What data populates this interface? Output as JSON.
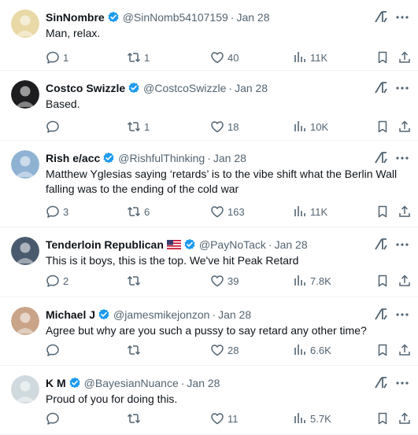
{
  "tweets": [
    {
      "name": "SinNombre",
      "handle": "@SinNomb54107159",
      "date": "Jan 28",
      "text": "Man, relax.",
      "replies": "1",
      "reposts": "1",
      "likes": "40",
      "views": "11K",
      "avatar_color": "#e9d9a6",
      "flag": false
    },
    {
      "name": "Costco Swizzle",
      "handle": "@CostcoSwizzle",
      "date": "Jan 28",
      "text": "Based.",
      "replies": "",
      "reposts": "1",
      "likes": "18",
      "views": "10K",
      "avatar_color": "#1d1d1f",
      "flag": false
    },
    {
      "name": "Rish e/acc",
      "handle": "@RishfulThinking",
      "date": "Jan 28",
      "text": "Matthew Yglesias saying ‘retards’ is to the vibe shift what the Berlin Wall falling was to the ending of the cold war",
      "replies": "3",
      "reposts": "6",
      "likes": "163",
      "views": "11K",
      "avatar_color": "#8fb2d3",
      "flag": false
    },
    {
      "name": "Tenderloin Republican",
      "handle": "@PayNoTack",
      "date": "Jan 28",
      "text": "This is it boys, this is the top. We've hit Peak Retard",
      "replies": "2",
      "reposts": "",
      "likes": "39",
      "views": "7.8K",
      "avatar_color": "#4a5a6e",
      "flag": true
    },
    {
      "name": "Michael J",
      "handle": "@jamesmikejonzon",
      "date": "Jan 28",
      "text": "Agree but why are you such a pussy to say retard any other time?",
      "replies": "",
      "reposts": "",
      "likes": "28",
      "views": "6.6K",
      "avatar_color": "#c9a489",
      "flag": false
    },
    {
      "name": "K M",
      "handle": "@BayesianNuance",
      "date": "Jan 28",
      "text": "Proud of you for doing this.",
      "replies": "",
      "reposts": "",
      "likes": "11",
      "views": "5.7K",
      "avatar_color": "#cfd9de",
      "flag": false
    }
  ],
  "colors": {
    "verified": "#1d9bf0",
    "muted": "#536471",
    "text": "#0f1419",
    "divider": "#eff3f4"
  },
  "icons": [
    "verified-badge-icon",
    "grok-icon",
    "more-icon",
    "reply-icon",
    "repost-icon",
    "like-icon",
    "views-icon",
    "bookmark-icon",
    "share-icon",
    "us-flag-icon"
  ]
}
